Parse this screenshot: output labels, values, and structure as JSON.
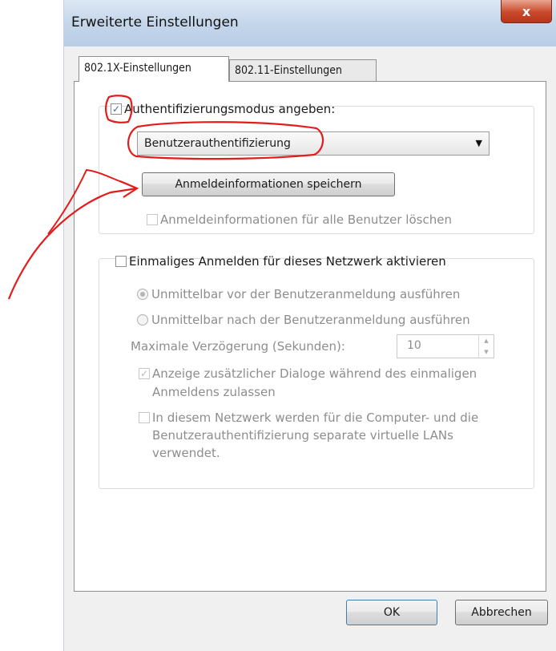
{
  "window": {
    "title": "Erweiterte Einstellungen",
    "close_glyph": "x"
  },
  "tabs": [
    {
      "label": "802.1X-Einstellungen",
      "active": true
    },
    {
      "label": "802.11-Einstellungen",
      "active": false
    }
  ],
  "auth": {
    "mode_checkbox_label": "Authentifizierungsmodus angeben:",
    "mode_checked": true,
    "mode_value": "Benutzerauthentifizierung",
    "save_button": "Anmeldeinformationen speichern",
    "delete_checkbox_label": "Anmeldeinformationen für alle Benutzer löschen",
    "delete_checked": false
  },
  "sso": {
    "enable_label": "Einmaliges Anmelden für dieses Netzwerk aktivieren",
    "enable_checked": false,
    "radio_before": "Unmittelbar vor der Benutzeranmeldung ausführen",
    "radio_before_selected": true,
    "radio_after": "Unmittelbar nach der Benutzeranmeldung ausführen",
    "radio_after_selected": false,
    "delay_label": "Maximale Verzögerung (Sekunden):",
    "delay_value": "10",
    "dialogs_line1": "Anzeige zusätzlicher Dialoge während des einmaligen",
    "dialogs_line2": "Anmeldens zulassen",
    "dialogs_checked": true,
    "vlan_line1": "In diesem Netzwerk werden für die Computer- und die",
    "vlan_line2": "Benutzerauthentifizierung separate virtuelle LANs",
    "vlan_line3": "verwendet.",
    "vlan_checked": false
  },
  "footer": {
    "ok": "OK",
    "cancel": "Abbrechen"
  },
  "colors": {
    "annotation": "#e31b1b",
    "titlebar": "#c3d5ea",
    "close": "#c9492b"
  },
  "icons": {
    "check": "✓",
    "dropdown": "▼",
    "spin_up": "▲",
    "spin_down": "▼"
  }
}
